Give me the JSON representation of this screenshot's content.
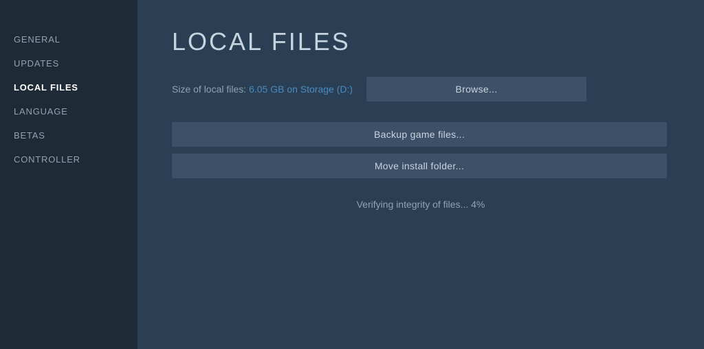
{
  "sidebar": {
    "items": [
      {
        "id": "general",
        "label": "GENERAL",
        "active": false
      },
      {
        "id": "updates",
        "label": "UPDATES",
        "active": false
      },
      {
        "id": "local-files",
        "label": "LOCAL FILES",
        "active": true
      },
      {
        "id": "language",
        "label": "LANGUAGE",
        "active": false
      },
      {
        "id": "betas",
        "label": "BETAS",
        "active": false
      },
      {
        "id": "controller",
        "label": "CONTROLLER",
        "active": false
      }
    ]
  },
  "main": {
    "page_title": "LOCAL FILES",
    "file_size_label": "Size of local files:",
    "file_size_value": "6.05 GB on Storage (D:)",
    "browse_label": "Browse...",
    "backup_label": "Backup game files...",
    "move_install_label": "Move install folder...",
    "verify_text": "Verifying integrity of files... 4%"
  }
}
